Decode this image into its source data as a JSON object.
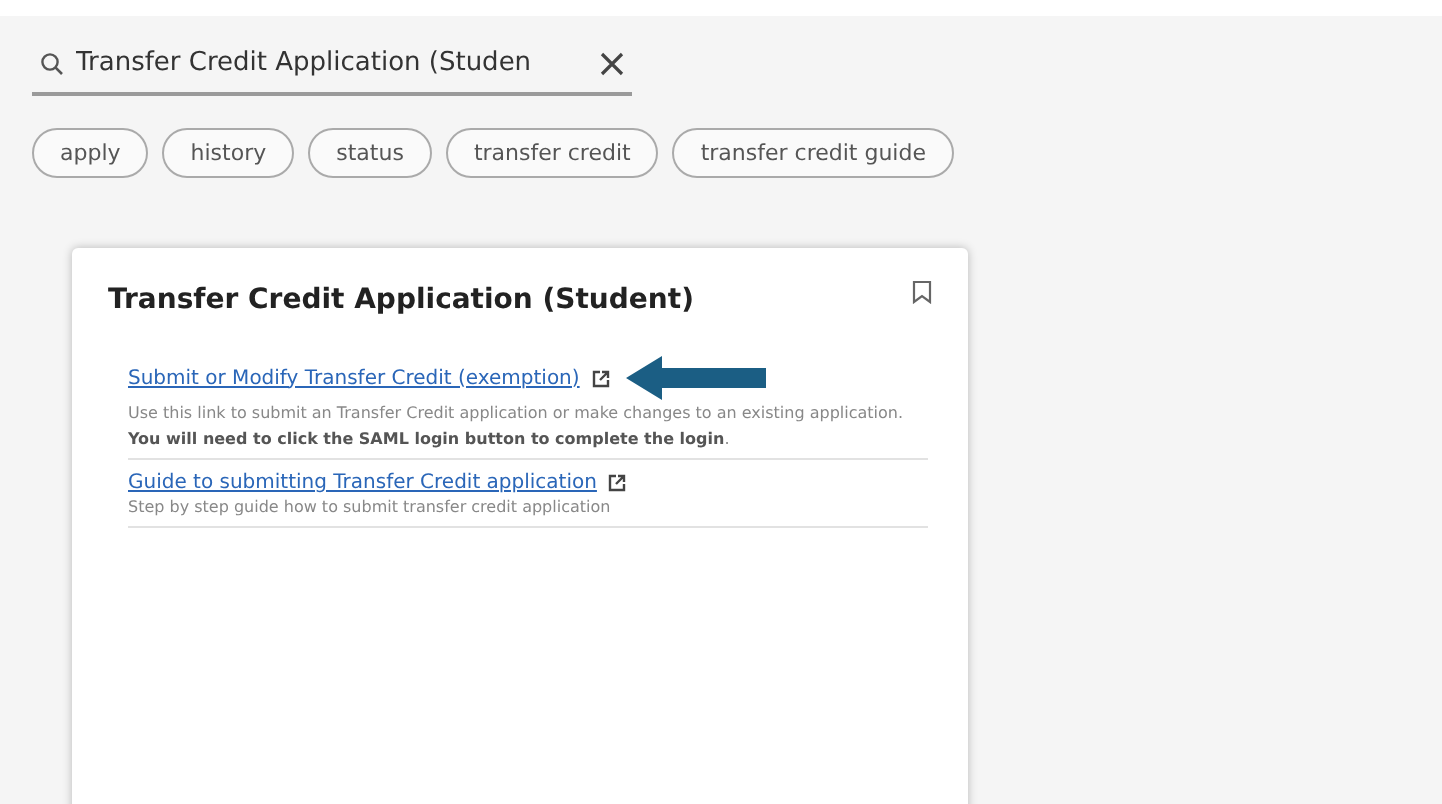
{
  "search": {
    "value": "Transfer Credit Application (Studen"
  },
  "chips": [
    "apply",
    "history",
    "status",
    "transfer credit",
    "transfer credit guide"
  ],
  "card": {
    "title": "Transfer Credit Application (Student)",
    "bookmarked": false,
    "links": [
      {
        "label": "Submit or Modify Transfer Credit (exemption)",
        "description": "Use this link to submit an Transfer Credit application or make changes to an existing application. **You will need to click the SAML login button to complete the login**.",
        "highlighted": true
      },
      {
        "label": "Guide to submitting Transfer Credit application",
        "description": "Step by step guide how to submit transfer credit application",
        "highlighted": false
      }
    ]
  }
}
